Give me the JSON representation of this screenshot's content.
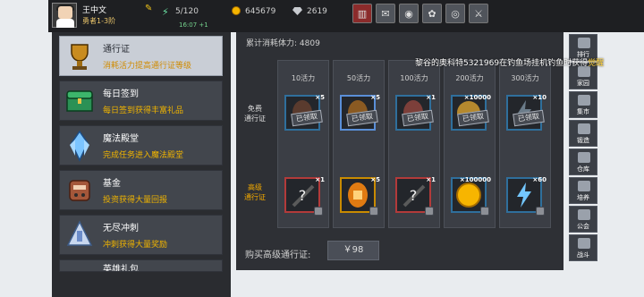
{
  "player": {
    "name": "王中文",
    "rank": "勇者1-3阶"
  },
  "energy": {
    "value": "5/120",
    "timer": "16:07 +1"
  },
  "currency": {
    "gold": "645679",
    "gems": "2619"
  },
  "top_buttons": [
    "shop-icon",
    "mail-icon",
    "gamepad-icon",
    "settings-icon",
    "color-wheel-icon",
    "sword-icon"
  ],
  "menu": [
    {
      "title": "通行证",
      "subtitle": "消耗活力提高通行证等级",
      "icon": "trophy-icon"
    },
    {
      "title": "每日签到",
      "subtitle": "每日签到获得丰富礼品",
      "icon": "chest-icon"
    },
    {
      "title": "魔法殿堂",
      "subtitle": "完成任务进入魔法殿堂",
      "icon": "crystal-icon"
    },
    {
      "title": "基金",
      "subtitle": "投资获得大量回报",
      "icon": "fund-icon"
    },
    {
      "title": "无尽冲刺",
      "subtitle": "冲刺获得大量奖励",
      "icon": "sprint-icon"
    },
    {
      "title": "英雄礼包",
      "subtitle": "",
      "icon": "gift-icon"
    }
  ],
  "pass": {
    "total_label": "累计消耗体力: 4809",
    "free_label": "免费\n通行证",
    "premium_label": "高级\n通行证",
    "columns": [
      {
        "head": "10活力",
        "free_mult": "×5",
        "premium_mult": "×1",
        "free_state": "已领取"
      },
      {
        "head": "50活力",
        "free_mult": "×5",
        "premium_mult": "×5",
        "free_state": "已领取"
      },
      {
        "head": "100活力",
        "free_mult": "×1",
        "premium_mult": "×1",
        "free_state": "已领取"
      },
      {
        "head": "200活力",
        "free_mult": "×10000",
        "premium_mult": "×100000",
        "free_state": "已领取"
      },
      {
        "head": "300活力",
        "free_mult": "×10",
        "premium_mult": "×60",
        "free_state": "已领取"
      }
    ],
    "buy_label": "购买高级通行证:",
    "buy_price": "￥98"
  },
  "right_menu": [
    {
      "label": "排行",
      "icon": "rank-icon"
    },
    {
      "label": "家园",
      "icon": "home-icon"
    },
    {
      "label": "集市",
      "icon": "market-icon"
    },
    {
      "label": "锻造",
      "icon": "anvil-icon"
    },
    {
      "label": "仓库",
      "icon": "warehouse-icon"
    },
    {
      "label": "培养",
      "icon": "train-icon"
    },
    {
      "label": "公会",
      "icon": "guild-icon"
    },
    {
      "label": "战斗",
      "icon": "battle-icon"
    }
  ],
  "marquee": {
    "text": "黎谷的奥科特5321969在钓鱼场挂机钓鱼时获得",
    "highlight": "觉醒"
  }
}
